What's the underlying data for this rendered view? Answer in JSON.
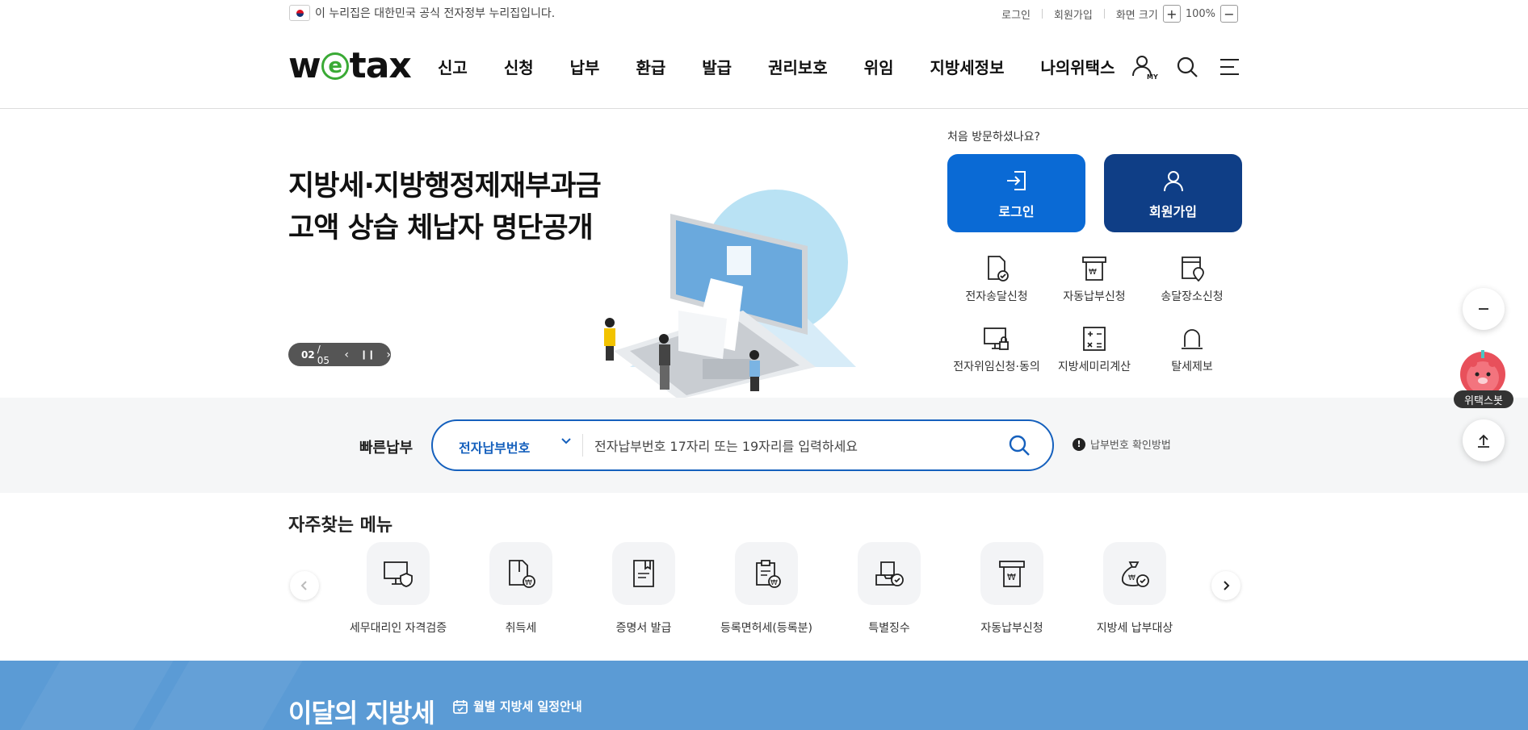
{
  "topbar": {
    "gov_notice": "이 누리집은 대한민국 공식 전자정부 누리집입니다.",
    "login": "로그인",
    "signup": "회원가입",
    "zoom_label": "화면 크기",
    "zoom_in": "+",
    "zoom_value": "100%",
    "zoom_out": "−"
  },
  "header": {
    "logo_w": "w",
    "logo_e": "e",
    "logo_rest": "tax",
    "nav": [
      "신고",
      "신청",
      "납부",
      "환급",
      "발급",
      "권리보호",
      "위임",
      "지방세정보",
      "나의위택스"
    ],
    "my_label": "MY"
  },
  "hero": {
    "title_line1": "지방세·지방행정제재부과금",
    "title_line2": "고액 상습 체납자 명단공개",
    "pager_current": "02",
    "pager_total": "/ 05"
  },
  "quick": {
    "heading": "처음 방문하셨나요?",
    "login": "로그인",
    "signup": "회원가입",
    "colors": {
      "login": "#0a6ad5",
      "signup": "#0f3e86"
    },
    "items": [
      "전자송달신청",
      "자동납부신청",
      "송달장소신청",
      "전자위임신청·동의",
      "지방세미리계산",
      "탈세제보"
    ]
  },
  "search": {
    "label": "빠른납부",
    "selected_option": "전자납부번호",
    "placeholder": "전자납부번호 17자리 또는 19자리를 입력하세요",
    "howto": "납부번호 확인방법"
  },
  "frequent": {
    "heading": "자주찾는 메뉴",
    "items": [
      "세무대리인 자격검증",
      "취득세",
      "증명서 발급",
      "등록면허세(등록분)",
      "특별징수",
      "자동납부신청",
      "지방세 납부대상"
    ]
  },
  "monthly": {
    "title": "이달의 지방세",
    "link": "월별 지방세 일정안내"
  },
  "side": {
    "bot_label": "위택스봇"
  }
}
